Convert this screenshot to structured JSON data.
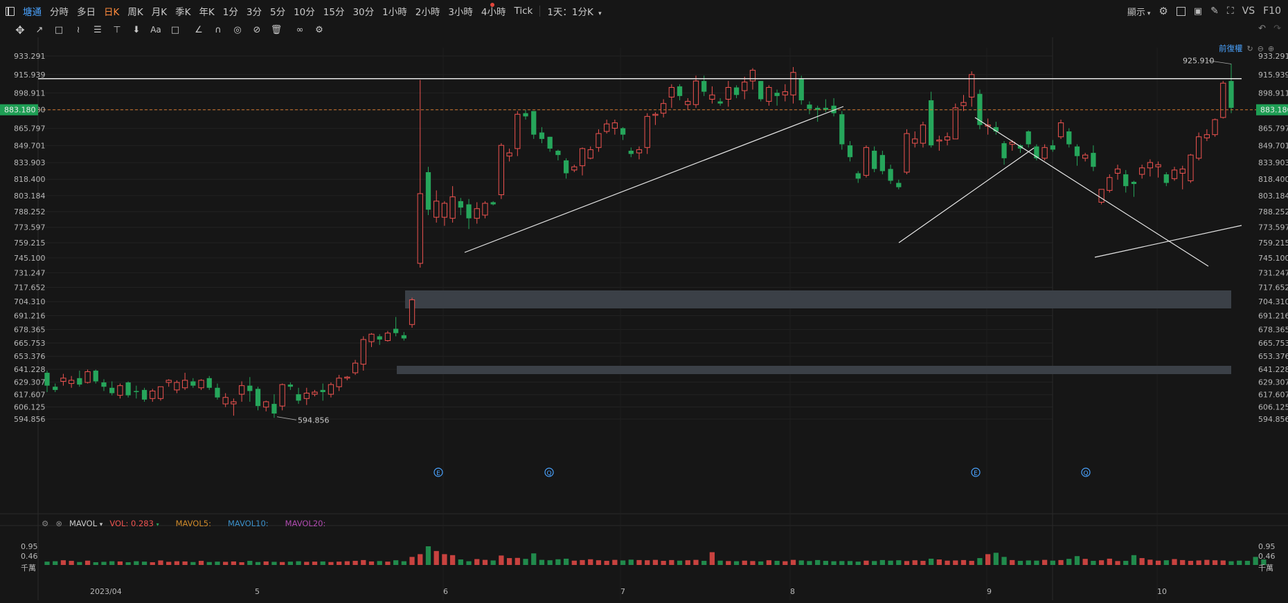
{
  "timeframes": [
    "塘通",
    "分時",
    "多日",
    "日K",
    "周K",
    "月K",
    "季K",
    "年K",
    "1分",
    "3分",
    "5分",
    "10分",
    "15分",
    "30分",
    "1小時",
    "2小時",
    "3小時",
    "4小時",
    "Tick"
  ],
  "active_timeframe": "日K",
  "interval_selector": "1天：1分K",
  "right_toolbar": {
    "display_label": "顯示",
    "vs_label": "VS",
    "f10_label": "F10"
  },
  "adjust_label": "前復權",
  "price_axis": {
    "ticks": [
      "933.291",
      "915.939",
      "898.911",
      "883.180",
      "865.797",
      "849.701",
      "833.903",
      "818.400",
      "803.184",
      "788.252",
      "773.597",
      "759.215",
      "745.100",
      "731.247",
      "717.652",
      "704.310",
      "691.216",
      "678.365",
      "665.753",
      "653.376",
      "641.228",
      "629.307",
      "617.607",
      "606.125",
      "594.856"
    ],
    "ymax": 933.291,
    "ymin": 594.856,
    "current_price": "883.180",
    "current_color": "#1e9e54"
  },
  "annotations": {
    "high_label": "925.910",
    "low_label": "594.856",
    "event_markers": [
      "E",
      "Q",
      "E",
      "Q"
    ]
  },
  "x_axis": {
    "labels": [
      "2023/04",
      "5",
      "6",
      "7",
      "8",
      "9",
      "10"
    ]
  },
  "volume_panel": {
    "indicator_name": "MAVOL",
    "vol_label": "VOL:",
    "vol_value": "0.283",
    "ma5_label": "MAVOL5:",
    "ma10_label": "MAVOL10:",
    "ma20_label": "MAVOL20:",
    "ticks": [
      "0.95",
      "0.46",
      "千萬"
    ]
  },
  "colors": {
    "up": "#ef5350",
    "down": "#26a65b",
    "ma5": "#d08a2a",
    "ma10": "#3a8fc9",
    "ma20": "#b04ab0",
    "accent_orange": "#ff8a3c",
    "link_blue": "#4aa3ff"
  },
  "chart_data": {
    "type": "candlestick",
    "ylim": [
      594.856,
      933.291
    ],
    "candles": [
      {
        "o": 638,
        "h": 640,
        "l": 620,
        "c": 626
      },
      {
        "o": 625,
        "h": 628,
        "l": 620,
        "c": 622
      },
      {
        "o": 630,
        "h": 637,
        "l": 626,
        "c": 633
      },
      {
        "o": 628,
        "h": 635,
        "l": 624,
        "c": 631
      },
      {
        "o": 633,
        "h": 640,
        "l": 625,
        "c": 627
      },
      {
        "o": 629,
        "h": 641,
        "l": 628,
        "c": 639
      },
      {
        "o": 640,
        "h": 641,
        "l": 628,
        "c": 630
      },
      {
        "o": 629,
        "h": 632,
        "l": 621,
        "c": 625
      },
      {
        "o": 624,
        "h": 630,
        "l": 617,
        "c": 619
      },
      {
        "o": 617,
        "h": 628,
        "l": 614,
        "c": 626
      },
      {
        "o": 629,
        "h": 630,
        "l": 615,
        "c": 617
      },
      {
        "o": 621,
        "h": 626,
        "l": 614,
        "c": 620
      },
      {
        "o": 622,
        "h": 624,
        "l": 611,
        "c": 613
      },
      {
        "o": 614,
        "h": 623,
        "l": 611,
        "c": 621
      },
      {
        "o": 614,
        "h": 625,
        "l": 612,
        "c": 625
      },
      {
        "o": 629,
        "h": 632,
        "l": 625,
        "c": 631
      },
      {
        "o": 622,
        "h": 631,
        "l": 619,
        "c": 629
      },
      {
        "o": 624,
        "h": 638,
        "l": 622,
        "c": 631
      },
      {
        "o": 630,
        "h": 633,
        "l": 624,
        "c": 626
      },
      {
        "o": 624,
        "h": 632,
        "l": 622,
        "c": 631
      },
      {
        "o": 633,
        "h": 635,
        "l": 622,
        "c": 624
      },
      {
        "o": 624,
        "h": 628,
        "l": 613,
        "c": 615
      },
      {
        "o": 609,
        "h": 619,
        "l": 606,
        "c": 615
      },
      {
        "o": 609,
        "h": 614,
        "l": 598,
        "c": 611
      },
      {
        "o": 618,
        "h": 630,
        "l": 611,
        "c": 626
      },
      {
        "o": 626,
        "h": 634,
        "l": 611,
        "c": 621
      },
      {
        "o": 623,
        "h": 625,
        "l": 603,
        "c": 607
      },
      {
        "o": 606,
        "h": 612,
        "l": 602,
        "c": 611
      },
      {
        "o": 609,
        "h": 618,
        "l": 596,
        "c": 600
      },
      {
        "o": 607,
        "h": 628,
        "l": 603,
        "c": 627
      },
      {
        "o": 627,
        "h": 629,
        "l": 622,
        "c": 625
      },
      {
        "o": 618,
        "h": 624,
        "l": 609,
        "c": 612
      },
      {
        "o": 614,
        "h": 624,
        "l": 608,
        "c": 619
      },
      {
        "o": 618,
        "h": 622,
        "l": 616,
        "c": 620
      },
      {
        "o": 622,
        "h": 628,
        "l": 612,
        "c": 620
      },
      {
        "o": 618,
        "h": 629,
        "l": 615,
        "c": 627
      },
      {
        "o": 625,
        "h": 636,
        "l": 621,
        "c": 633
      },
      {
        "o": 633,
        "h": 635,
        "l": 631,
        "c": 634
      },
      {
        "o": 638,
        "h": 650,
        "l": 636,
        "c": 647
      },
      {
        "o": 646,
        "h": 672,
        "l": 640,
        "c": 669
      },
      {
        "o": 667,
        "h": 675,
        "l": 662,
        "c": 674
      },
      {
        "o": 672,
        "h": 674,
        "l": 664,
        "c": 669
      },
      {
        "o": 668,
        "h": 677,
        "l": 667,
        "c": 675
      },
      {
        "o": 679,
        "h": 690,
        "l": 672,
        "c": 675
      },
      {
        "o": 673,
        "h": 676,
        "l": 668,
        "c": 670
      },
      {
        "o": 683,
        "h": 708,
        "l": 680,
        "c": 706
      },
      {
        "o": 740,
        "h": 911,
        "l": 736,
        "c": 805
      },
      {
        "o": 825,
        "h": 830,
        "l": 785,
        "c": 790
      },
      {
        "o": 783,
        "h": 808,
        "l": 778,
        "c": 798
      },
      {
        "o": 783,
        "h": 798,
        "l": 775,
        "c": 796
      },
      {
        "o": 782,
        "h": 812,
        "l": 778,
        "c": 802
      },
      {
        "o": 798,
        "h": 801,
        "l": 785,
        "c": 792
      },
      {
        "o": 795,
        "h": 800,
        "l": 772,
        "c": 782
      },
      {
        "o": 782,
        "h": 797,
        "l": 777,
        "c": 791
      },
      {
        "o": 785,
        "h": 798,
        "l": 782,
        "c": 796
      },
      {
        "o": 797,
        "h": 798,
        "l": 794,
        "c": 795
      },
      {
        "o": 804,
        "h": 852,
        "l": 800,
        "c": 850
      },
      {
        "o": 840,
        "h": 847,
        "l": 835,
        "c": 843
      },
      {
        "o": 847,
        "h": 882,
        "l": 840,
        "c": 879
      },
      {
        "o": 880,
        "h": 883,
        "l": 874,
        "c": 877
      },
      {
        "o": 882,
        "h": 882,
        "l": 856,
        "c": 860
      },
      {
        "o": 862,
        "h": 867,
        "l": 852,
        "c": 856
      },
      {
        "o": 858,
        "h": 858,
        "l": 844,
        "c": 847
      },
      {
        "o": 845,
        "h": 846,
        "l": 836,
        "c": 841
      },
      {
        "o": 836,
        "h": 838,
        "l": 819,
        "c": 824
      },
      {
        "o": 827,
        "h": 832,
        "l": 825,
        "c": 830
      },
      {
        "o": 831,
        "h": 848,
        "l": 822,
        "c": 847
      },
      {
        "o": 838,
        "h": 849,
        "l": 837,
        "c": 846
      },
      {
        "o": 848,
        "h": 865,
        "l": 844,
        "c": 861
      },
      {
        "o": 863,
        "h": 874,
        "l": 861,
        "c": 870
      },
      {
        "o": 866,
        "h": 874,
        "l": 860,
        "c": 871
      },
      {
        "o": 866,
        "h": 867,
        "l": 855,
        "c": 860
      },
      {
        "o": 845,
        "h": 848,
        "l": 839,
        "c": 842
      },
      {
        "o": 843,
        "h": 849,
        "l": 837,
        "c": 846
      },
      {
        "o": 848,
        "h": 880,
        "l": 842,
        "c": 877
      },
      {
        "o": 878,
        "h": 881,
        "l": 869,
        "c": 879
      },
      {
        "o": 880,
        "h": 893,
        "l": 876,
        "c": 889
      },
      {
        "o": 895,
        "h": 907,
        "l": 885,
        "c": 904
      },
      {
        "o": 905,
        "h": 907,
        "l": 892,
        "c": 896
      },
      {
        "o": 888,
        "h": 894,
        "l": 883,
        "c": 891
      },
      {
        "o": 888,
        "h": 915,
        "l": 885,
        "c": 910
      },
      {
        "o": 910,
        "h": 915,
        "l": 896,
        "c": 900
      },
      {
        "o": 893,
        "h": 905,
        "l": 889,
        "c": 897
      },
      {
        "o": 891,
        "h": 894,
        "l": 887,
        "c": 889
      },
      {
        "o": 893,
        "h": 910,
        "l": 886,
        "c": 904
      },
      {
        "o": 904,
        "h": 906,
        "l": 894,
        "c": 897
      },
      {
        "o": 901,
        "h": 914,
        "l": 893,
        "c": 909
      },
      {
        "o": 910,
        "h": 922,
        "l": 902,
        "c": 920
      },
      {
        "o": 910,
        "h": 910,
        "l": 891,
        "c": 893
      },
      {
        "o": 891,
        "h": 906,
        "l": 887,
        "c": 904
      },
      {
        "o": 899,
        "h": 902,
        "l": 887,
        "c": 896
      },
      {
        "o": 897,
        "h": 907,
        "l": 891,
        "c": 900
      },
      {
        "o": 897,
        "h": 923,
        "l": 889,
        "c": 918
      },
      {
        "o": 912,
        "h": 915,
        "l": 888,
        "c": 892
      },
      {
        "o": 888,
        "h": 891,
        "l": 879,
        "c": 884
      },
      {
        "o": 885,
        "h": 887,
        "l": 872,
        "c": 883
      },
      {
        "o": 885,
        "h": 893,
        "l": 881,
        "c": 883
      },
      {
        "o": 887,
        "h": 894,
        "l": 877,
        "c": 880
      },
      {
        "o": 879,
        "h": 882,
        "l": 846,
        "c": 851
      },
      {
        "o": 850,
        "h": 854,
        "l": 835,
        "c": 839
      },
      {
        "o": 824,
        "h": 826,
        "l": 815,
        "c": 819
      },
      {
        "o": 822,
        "h": 850,
        "l": 820,
        "c": 848
      },
      {
        "o": 845,
        "h": 849,
        "l": 825,
        "c": 828
      },
      {
        "o": 841,
        "h": 845,
        "l": 823,
        "c": 826
      },
      {
        "o": 828,
        "h": 832,
        "l": 814,
        "c": 817
      },
      {
        "o": 815,
        "h": 818,
        "l": 809,
        "c": 811
      },
      {
        "o": 825,
        "h": 865,
        "l": 823,
        "c": 861
      },
      {
        "o": 852,
        "h": 863,
        "l": 848,
        "c": 856
      },
      {
        "o": 852,
        "h": 872,
        "l": 848,
        "c": 869
      },
      {
        "o": 892,
        "h": 900,
        "l": 848,
        "c": 850
      },
      {
        "o": 854,
        "h": 859,
        "l": 845,
        "c": 855
      },
      {
        "o": 855,
        "h": 862,
        "l": 850,
        "c": 858
      },
      {
        "o": 856,
        "h": 889,
        "l": 856,
        "c": 885
      },
      {
        "o": 887,
        "h": 897,
        "l": 882,
        "c": 890
      },
      {
        "o": 895,
        "h": 919,
        "l": 886,
        "c": 916
      },
      {
        "o": 898,
        "h": 902,
        "l": 865,
        "c": 869
      },
      {
        "o": 868,
        "h": 875,
        "l": 860,
        "c": 869
      },
      {
        "o": 867,
        "h": 872,
        "l": 860,
        "c": 863
      },
      {
        "o": 852,
        "h": 854,
        "l": 832,
        "c": 838
      },
      {
        "o": 851,
        "h": 855,
        "l": 845,
        "c": 853
      },
      {
        "o": 850,
        "h": 851,
        "l": 843,
        "c": 847
      },
      {
        "o": 863,
        "h": 864,
        "l": 848,
        "c": 851
      },
      {
        "o": 849,
        "h": 851,
        "l": 836,
        "c": 838
      },
      {
        "o": 838,
        "h": 851,
        "l": 836,
        "c": 848
      },
      {
        "o": 850,
        "h": 855,
        "l": 844,
        "c": 846
      },
      {
        "o": 858,
        "h": 874,
        "l": 856,
        "c": 871
      },
      {
        "o": 863,
        "h": 866,
        "l": 848,
        "c": 851
      },
      {
        "o": 849,
        "h": 851,
        "l": 831,
        "c": 840
      },
      {
        "o": 838,
        "h": 843,
        "l": 835,
        "c": 841
      },
      {
        "o": 843,
        "h": 850,
        "l": 826,
        "c": 830
      },
      {
        "o": 797,
        "h": 808,
        "l": 795,
        "c": 809
      },
      {
        "o": 808,
        "h": 823,
        "l": 806,
        "c": 820
      },
      {
        "o": 824,
        "h": 832,
        "l": 818,
        "c": 828
      },
      {
        "o": 823,
        "h": 827,
        "l": 806,
        "c": 812
      },
      {
        "o": 816,
        "h": 817,
        "l": 802,
        "c": 814
      },
      {
        "o": 823,
        "h": 832,
        "l": 819,
        "c": 829
      },
      {
        "o": 829,
        "h": 837,
        "l": 821,
        "c": 834
      },
      {
        "o": 830,
        "h": 835,
        "l": 820,
        "c": 832
      },
      {
        "o": 823,
        "h": 825,
        "l": 812,
        "c": 815
      },
      {
        "o": 819,
        "h": 830,
        "l": 817,
        "c": 827
      },
      {
        "o": 824,
        "h": 831,
        "l": 809,
        "c": 828
      },
      {
        "o": 817,
        "h": 842,
        "l": 815,
        "c": 841
      },
      {
        "o": 838,
        "h": 862,
        "l": 836,
        "c": 858
      },
      {
        "o": 857,
        "h": 865,
        "l": 854,
        "c": 860
      },
      {
        "o": 860,
        "h": 875,
        "l": 858,
        "c": 874
      },
      {
        "o": 876,
        "h": 910,
        "l": 875,
        "c": 908
      },
      {
        "o": 910,
        "h": 926,
        "l": 880,
        "c": 885
      }
    ],
    "volumes": [
      0.17,
      0.19,
      0.24,
      0.21,
      0.15,
      0.22,
      0.14,
      0.16,
      0.19,
      0.18,
      0.14,
      0.19,
      0.17,
      0.14,
      0.23,
      0.16,
      0.19,
      0.18,
      0.15,
      0.21,
      0.15,
      0.17,
      0.16,
      0.18,
      0.14,
      0.21,
      0.15,
      0.18,
      0.16,
      0.15,
      0.17,
      0.19,
      0.16,
      0.17,
      0.18,
      0.15,
      0.17,
      0.19,
      0.21,
      0.25,
      0.18,
      0.2,
      0.17,
      0.24,
      0.19,
      0.41,
      0.55,
      0.95,
      0.71,
      0.55,
      0.5,
      0.28,
      0.19,
      0.3,
      0.26,
      0.23,
      0.48,
      0.35,
      0.36,
      0.31,
      0.59,
      0.26,
      0.24,
      0.29,
      0.32,
      0.22,
      0.25,
      0.29,
      0.24,
      0.21,
      0.26,
      0.23,
      0.27,
      0.25,
      0.24,
      0.26,
      0.21,
      0.25,
      0.22,
      0.24,
      0.26,
      0.21,
      0.65,
      0.22,
      0.2,
      0.19,
      0.22,
      0.2,
      0.18,
      0.24,
      0.21,
      0.19,
      0.26,
      0.23,
      0.2,
      0.25,
      0.21,
      0.19,
      0.2,
      0.2,
      0.17,
      0.22,
      0.2,
      0.25,
      0.22,
      0.24,
      0.2,
      0.24,
      0.21,
      0.32,
      0.28,
      0.22,
      0.23,
      0.25,
      0.21,
      0.35,
      0.55,
      0.62,
      0.41,
      0.25,
      0.21,
      0.23,
      0.22,
      0.26,
      0.22,
      0.25,
      0.31,
      0.45,
      0.31,
      0.21,
      0.24,
      0.32,
      0.2,
      0.21,
      0.5,
      0.35,
      0.27,
      0.22,
      0.24,
      0.3,
      0.25,
      0.21,
      0.23,
      0.26,
      0.24,
      0.23,
      0.19,
      0.22,
      0.21,
      0.41,
      0.28
    ]
  }
}
